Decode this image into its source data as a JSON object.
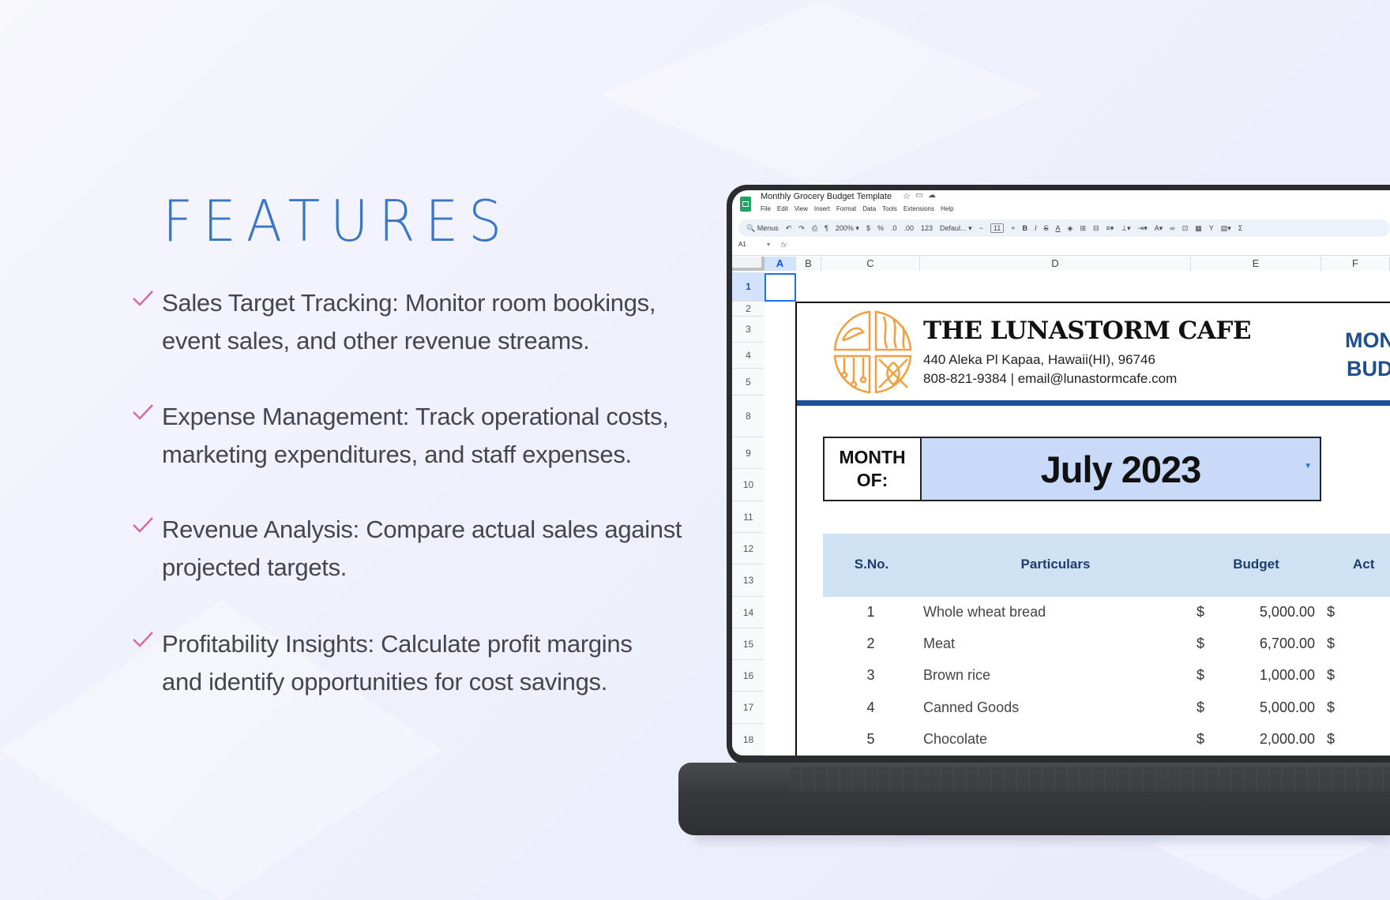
{
  "features": {
    "title": "FEATURES",
    "check_color": "#d46aa0",
    "items": [
      {
        "icon": "check-icon",
        "line1": "Sales Target Tracking: Monitor room bookings,",
        "line2": "event sales, and other revenue streams."
      },
      {
        "icon": "check-icon",
        "line1": "Expense Management: Track operational costs,",
        "line2": "marketing expenditures, and staff expenses."
      },
      {
        "icon": "check-icon",
        "line1": "Revenue Analysis: Compare actual sales against",
        "line2": "projected targets."
      },
      {
        "icon": "check-icon",
        "line1": "Profitability Insights: Calculate profit margins",
        "line2": "and identify opportunities for cost savings."
      }
    ]
  },
  "sheet": {
    "doc_title": "Monthly Grocery Budget Template",
    "menu": [
      "File",
      "Edit",
      "View",
      "Insert",
      "Format",
      "Data",
      "Tools",
      "Extensions",
      "Help"
    ],
    "toolbar": {
      "search": "Menus",
      "zoom": "200%",
      "font": "Defaul...",
      "font_size": "11",
      "currency": "$",
      "percent": "%",
      "dec_less": ".0",
      "dec_more": ".00",
      "format_123": "123"
    },
    "name_box": "A1",
    "fx": "fx",
    "columns": [
      "A",
      "B",
      "C",
      "D",
      "E",
      "F"
    ],
    "rows": [
      "1",
      "2",
      "3",
      "4",
      "5",
      "8",
      "9",
      "10",
      "11",
      "12",
      "13",
      "14",
      "15",
      "16",
      "17",
      "18"
    ],
    "company": {
      "name": "THE LUNASTORM CAFE",
      "address": "440 Aleka Pl Kapaa, Hawaii(HI), 96746",
      "contact": "808-821-9384 | email@lunastormcafe.com",
      "logo_color": "#f0a040"
    },
    "doc_heading": {
      "line1": "MON",
      "line2": "BUD"
    },
    "month": {
      "label_line1": "MONTH",
      "label_line2": "OF:",
      "value": "July 2023"
    },
    "table": {
      "headers": [
        "S.No.",
        "Particulars",
        "Budget",
        "Act"
      ],
      "rows": [
        {
          "sno": "1",
          "item": "Whole wheat bread",
          "cur": "$",
          "budget": "5,000.00",
          "cur2": "$"
        },
        {
          "sno": "2",
          "item": "Meat",
          "cur": "$",
          "budget": "6,700.00",
          "cur2": "$"
        },
        {
          "sno": "3",
          "item": "Brown rice",
          "cur": "$",
          "budget": "1,000.00",
          "cur2": "$"
        },
        {
          "sno": "4",
          "item": "Canned Goods",
          "cur": "$",
          "budget": "5,000.00",
          "cur2": "$"
        },
        {
          "sno": "5",
          "item": "Chocolate",
          "cur": "$",
          "budget": "2,000.00",
          "cur2": "$"
        }
      ]
    },
    "colors": {
      "accent_bar": "#1c4f9c",
      "month_fill": "#c9daf8",
      "header_fill": "#cfe2f3",
      "header_text": "#1f3d6b"
    }
  }
}
